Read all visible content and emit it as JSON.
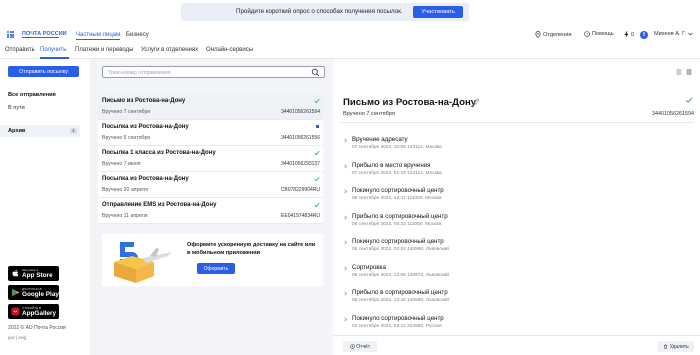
{
  "survey": {
    "text": "Пройдите короткий опрос о способах получения посылок.",
    "button": "Участвовать"
  },
  "header": {
    "logo": "ПОЧТА РОССИИ",
    "nav_private": "Частным лицам",
    "nav_business": "Бизнесу",
    "offices": "Отделения",
    "help": "Помощь",
    "notif_count": "0",
    "badge": "5",
    "user": "Михеев А. Г."
  },
  "tabs": [
    "Отправить",
    "Получить",
    "Платежи и переводы",
    "Услуги в отделениях",
    "Онлайн-сервисы"
  ],
  "sidebar": {
    "send_button": "Отправить посылку",
    "all_heading": "Все отправления",
    "in_transit": "В пути",
    "archive": "Архив",
    "archive_count": "1",
    "stores": [
      {
        "small": "Загрузите в",
        "big": "App Store"
      },
      {
        "small": "ДОСТУПНО В",
        "big": "Google Play"
      },
      {
        "small": "ОТКРОЙТЕ В",
        "big": "AppGallery"
      }
    ],
    "copyright": "2022 © АО Почта России",
    "links": "pur | eng"
  },
  "search": {
    "placeholder": "Трек-номер отправления"
  },
  "shipments": [
    {
      "title": "Письмо из Ростова-на-Дону",
      "date": "Вручено 7 сентября",
      "number": "34401056261594",
      "mark": "check",
      "selected": true
    },
    {
      "title": "Посылка из Ростова-на-Дону",
      "date": "Вручено 6 сентября",
      "number": "34401056261556",
      "mark": "dot",
      "selected": false
    },
    {
      "title": "Посылка 1 класса из Ростова-на-Дону",
      "date": "Вручено 7 июля",
      "number": "34401056293137",
      "mark": "check",
      "selected": false
    },
    {
      "title": "Посылка из Ростова-на-Дону",
      "date": "Вручено 20 апреля",
      "number": "CB078229904RU",
      "mark": "check",
      "selected": false
    },
    {
      "title": "Отправление EMS из Ростова-на-Дону",
      "date": "Вручено 11 апреля",
      "number": "EE041574834RU",
      "mark": "check",
      "selected": false
    }
  ],
  "promo": {
    "text": "Оформите ускоренную доставку на сайте или в мобильном приложении",
    "button": "Оформить"
  },
  "detail": {
    "title": "Письмо из Ростова-на-Дону",
    "subtitle": "Вручено 7 сентября",
    "number": "34401056261594",
    "events": [
      {
        "title": "Вручение адресату",
        "date": "07 сентября 2022, 10:59 123112, Москва"
      },
      {
        "title": "Прибыло в место вручения",
        "date": "07 сентября 2022, 01:19 123112, Москва"
      },
      {
        "title": "Покинуло сортировочный центр",
        "date": "06 сентября 2022, 12:47 111050, Москва"
      },
      {
        "title": "Прибыло в сортировочный центр",
        "date": "06 сентября 2022, 05:22 111050, Москва"
      },
      {
        "title": "Покинуло сортировочный центр",
        "date": "06 сентября 2022, 02:52 140960, Львовский"
      },
      {
        "title": "Сортировка",
        "date": "05 сентября 2022, 12:56 140974, Львовский"
      },
      {
        "title": "Прибыло в сортировочный центр",
        "date": "05 сентября 2022, 12:42 140960, Львовский"
      },
      {
        "title": "Покинуло сортировочный центр",
        "date": "04 сентября 2022, 03:12 344960, Россия"
      }
    ],
    "report_button": "Отчёт",
    "delete_button": "Удалить"
  },
  "colors": {
    "accent": "#2a5ee8",
    "check": "#1fa35a",
    "panel": "#f3f4f7"
  }
}
